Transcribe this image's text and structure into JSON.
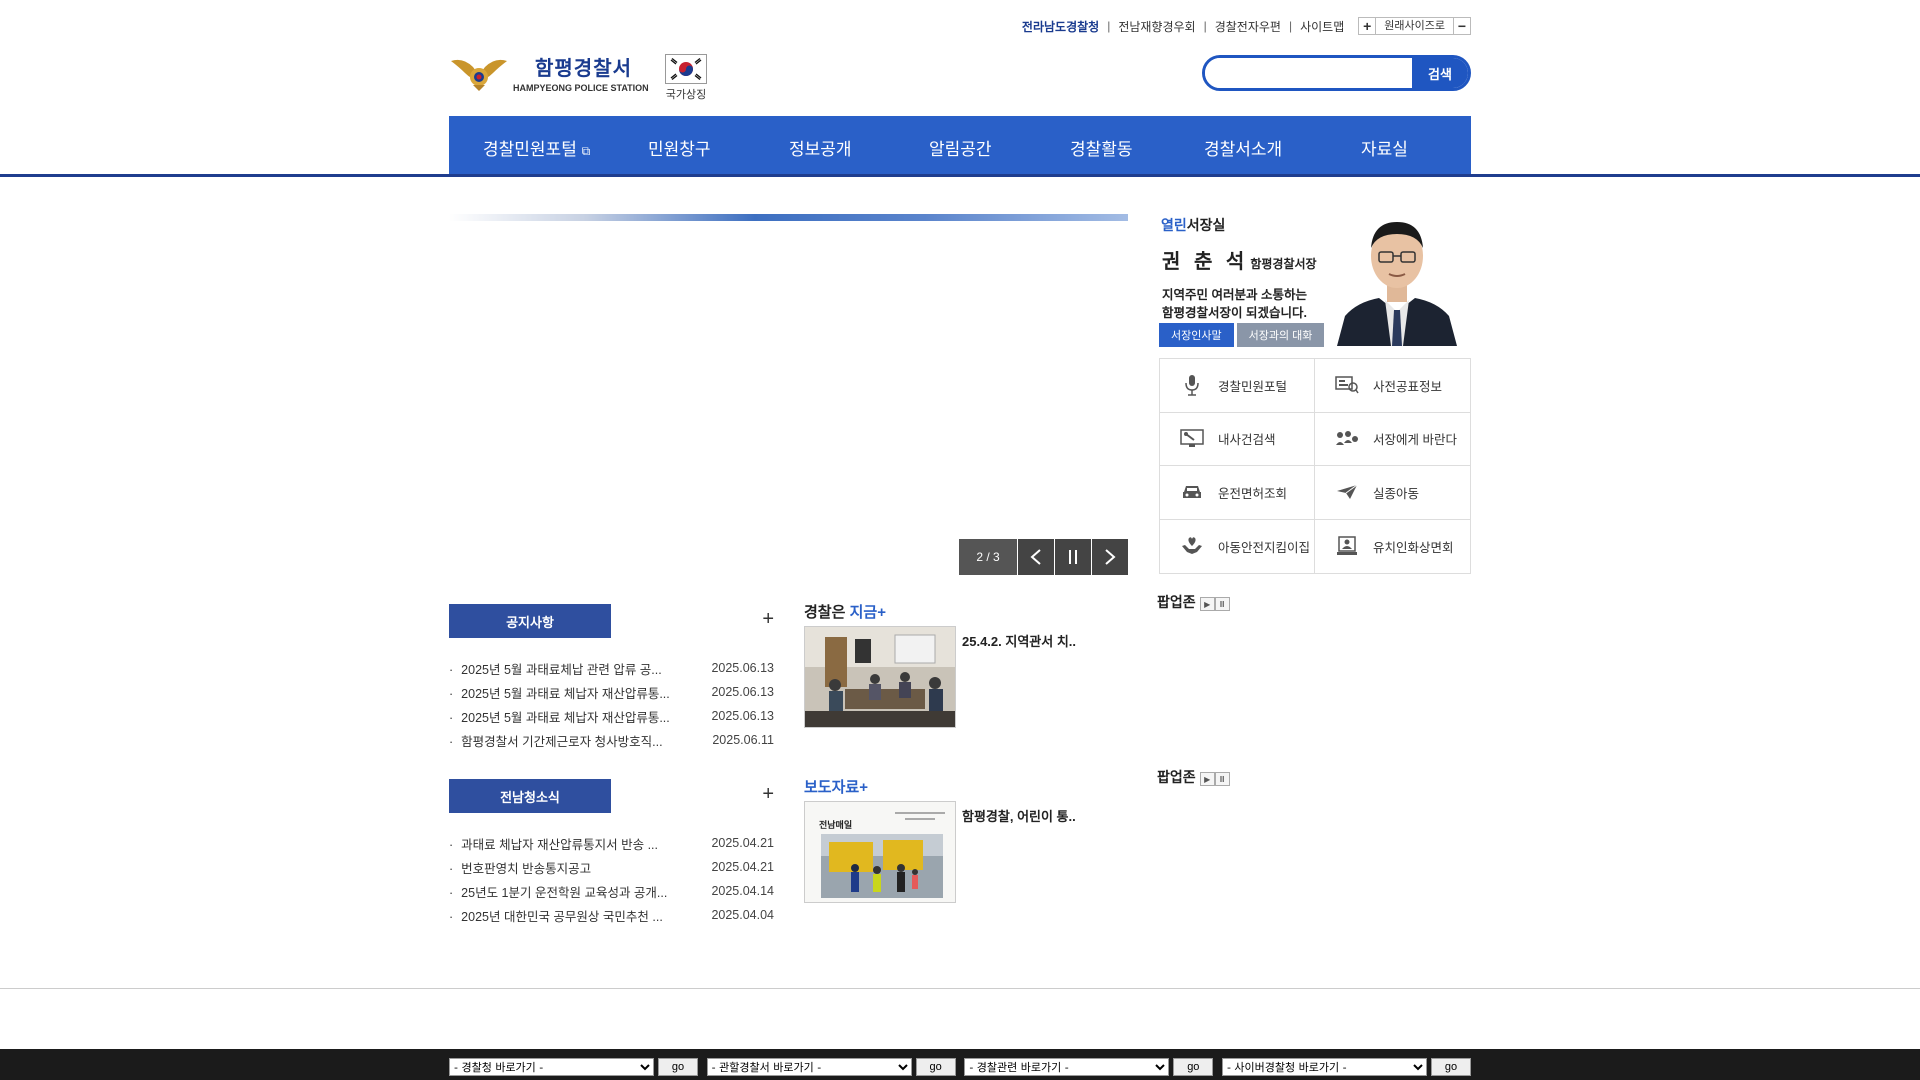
{
  "util": {
    "links": [
      "전라남도경찰청",
      "전남재향경우회",
      "경찰전자우편",
      "사이트맵"
    ],
    "original_size": "원래사이즈로",
    "plus": "+",
    "minus": "−"
  },
  "header": {
    "site_name_ko": "함평경찰서",
    "site_name_en": "HAMPYEONG POLICE STATION",
    "flag_label": "국가상징",
    "search_placeholder": "",
    "search_button": "검색"
  },
  "gnb": [
    "경찰민원포털",
    "민원창구",
    "정보공개",
    "알림공간",
    "경찰활동",
    "경찰서소개",
    "자료실"
  ],
  "slider": {
    "counter": "2 / 3",
    "prev": "‹",
    "pause": "||",
    "next": "›"
  },
  "chief": {
    "title_blue": "열린",
    "title": "서장실",
    "name": "권 춘 석",
    "name_sub": "함평경찰서장",
    "message_line1": "지역주민 여러분과 소통하는",
    "message_line2": "함평경찰서장이 되겠습니다.",
    "btn_greeting": "서장인사말",
    "btn_dialog": "서장과의 대화"
  },
  "quick_menu": [
    {
      "label": "경찰민원포털",
      "icon": "microphone-icon"
    },
    {
      "label": "사전공표정보",
      "icon": "info-board-icon"
    },
    {
      "label": "내사건검색",
      "icon": "monitor-search-icon"
    },
    {
      "label": "서장에게 바란다",
      "icon": "people-icon"
    },
    {
      "label": "운전면허조회",
      "icon": "car-icon"
    },
    {
      "label": "실종아동",
      "icon": "paper-plane-icon"
    },
    {
      "label": "아동안전지킴이집",
      "icon": "heart-hands-icon"
    },
    {
      "label": "유치인화상면회",
      "icon": "video-call-icon"
    }
  ],
  "notice": {
    "tab": "공지사항",
    "more": "+",
    "items": [
      {
        "title": "2025년 5월 과태료체납 관련 압류 공...",
        "date": "2025.06.13"
      },
      {
        "title": "2025년 5월 과태료 체납자 재산압류통...",
        "date": "2025.06.13"
      },
      {
        "title": "2025년 5월 과태료 체납자 재산압류통...",
        "date": "2025.06.13"
      },
      {
        "title": "함평경찰서 기간제근로자 청사방호직...",
        "date": "2025.06.11"
      }
    ]
  },
  "jeonnam": {
    "tab": "전남청소식",
    "more": "+",
    "items": [
      {
        "title": "과태료 체납자 재산압류통지서 반송 ...",
        "date": "2025.04.21"
      },
      {
        "title": "번호판영치 반송통지공고",
        "date": "2025.04.21"
      },
      {
        "title": "25년도 1분기 운전학원 교육성과 공개...",
        "date": "2025.04.14"
      },
      {
        "title": "2025년 대한민국 공무원상 국민추천 ...",
        "date": "2025.04.04"
      }
    ]
  },
  "police_now": {
    "head": "경찰은",
    "head_blue": "지금",
    "plus": "+",
    "caption": "25.4.2. 지역관서 치.."
  },
  "press": {
    "head": "보도자료",
    "plus": "+",
    "caption": "함평경찰, 어린이 통..",
    "img_text": "전남매일"
  },
  "popup": {
    "label": "팝업존",
    "play": "▶",
    "pause": "II"
  },
  "footer": {
    "selects": [
      "- 경찰청 바로가기 -",
      "- 관할경찰서 바로가기 -",
      "- 경찰관련 바로가기 -",
      "- 사이버경찰청 바로가기 -"
    ],
    "go": "go"
  },
  "colors": {
    "primary": "#2a60c8",
    "navy": "#1f3d8e",
    "tab": "#2f4f9f"
  }
}
